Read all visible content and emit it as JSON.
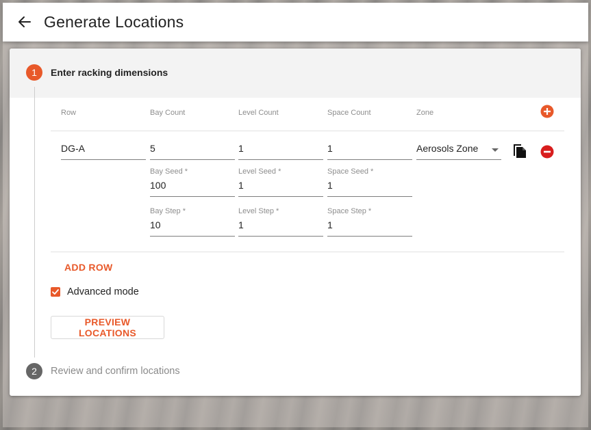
{
  "header": {
    "title": "Generate Locations"
  },
  "steps": [
    {
      "number": "1",
      "title": "Enter racking dimensions"
    },
    {
      "number": "2",
      "title": "Review and confirm locations"
    }
  ],
  "table": {
    "headers": {
      "row": "Row",
      "bay_count": "Bay Count",
      "level_count": "Level Count",
      "space_count": "Space Count",
      "zone": "Zone"
    },
    "rows": [
      {
        "row": "DG-A",
        "bay_count": "5",
        "level_count": "1",
        "space_count": "1",
        "zone": "Aerosols Zone",
        "bay_seed_label": "Bay Seed *",
        "bay_seed": "100",
        "level_seed_label": "Level Seed *",
        "level_seed": "1",
        "space_seed_label": "Space Seed *",
        "space_seed": "1",
        "bay_step_label": "Bay Step *",
        "bay_step": "10",
        "level_step_label": "Level Step *",
        "level_step": "1",
        "space_step_label": "Space Step *",
        "space_step": "1"
      }
    ]
  },
  "actions": {
    "add_row": "ADD ROW",
    "advanced_mode": "Advanced mode",
    "preview": "PREVIEW LOCATIONS"
  },
  "colors": {
    "accent": "#e8592a",
    "remove": "#d81e1e",
    "inactive_step": "#666666"
  },
  "icons": {
    "back": "arrow-left-icon",
    "add": "plus-circle-icon",
    "copy": "copy-icon",
    "remove": "minus-circle-icon",
    "check": "check-icon",
    "dropdown": "caret-down-icon"
  }
}
